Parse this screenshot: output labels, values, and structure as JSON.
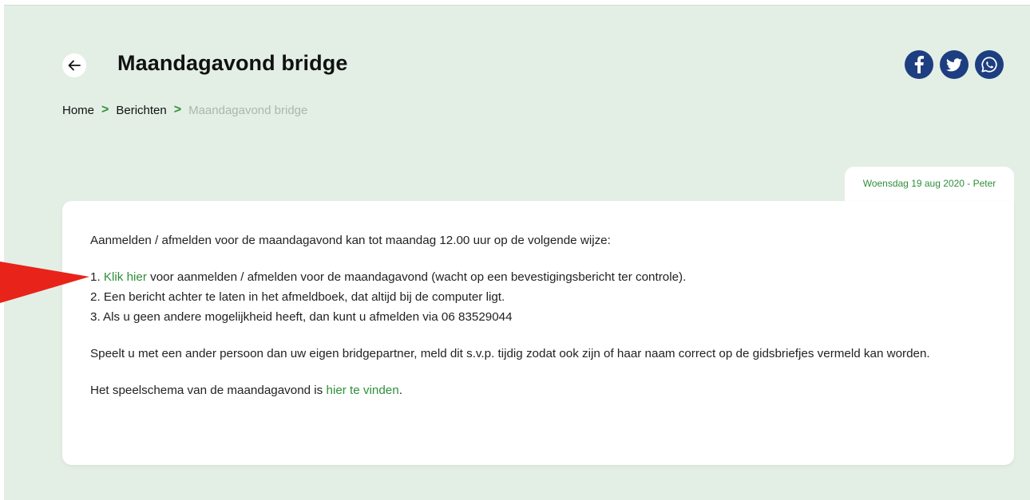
{
  "header": {
    "title": "Maandagavond bridge"
  },
  "share": [
    "facebook-icon",
    "twitter-icon",
    "whatsapp-icon"
  ],
  "breadcrumb": {
    "home": "Home",
    "berichten": "Berichten",
    "current": "Maandagavond bridge",
    "separator": ">"
  },
  "post": {
    "date_author": "Woensdag 19 aug 2020 - Peter",
    "intro": "Aanmelden / afmelden voor de maandagavond kan tot maandag 12.00 uur op de volgende wijze:",
    "item1_prefix": "1. ",
    "item1_link": "Klik hier",
    "item1_rest": " voor aanmelden / afmelden voor de maandagavond (wacht op een bevestigingsbericht ter controle).",
    "item2": "2. Een bericht achter te laten in het afmeldboek, dat altijd bij de computer ligt.",
    "item3": "3. Als u geen andere mogelijkheid heeft, dan kunt u afmelden via 06 83529044",
    "partner_note": "Speelt u met een ander persoon dan uw eigen bridgepartner, meld dit s.v.p. tijdig zodat ook zijn of haar naam correct op de gidsbriefjes vermeld kan worden.",
    "schedule_prefix": "Het speelschema van de maandagavond is ",
    "schedule_link": "hier te vinden",
    "schedule_suffix": "."
  },
  "colors": {
    "background": "#e3efe5",
    "accent_green": "#2f8f3a",
    "share_blue": "#1d3e80",
    "annotation_arrow": "#e8231a"
  }
}
